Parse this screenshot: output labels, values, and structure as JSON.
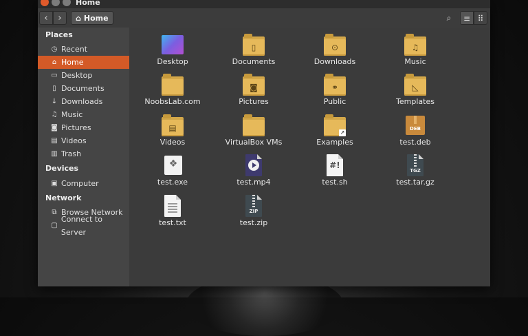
{
  "window": {
    "title": "Home"
  },
  "toolbar": {
    "back_icon": "‹",
    "forward_icon": "›",
    "breadcrumb_label": "Home",
    "search_icon": "⌕",
    "list_icon": "≡",
    "grid_icon": "⠿"
  },
  "sidebar": {
    "places_title": "Places",
    "places": [
      {
        "label": "Recent",
        "icon": "clock-icon",
        "glyph": "◷"
      },
      {
        "label": "Home",
        "icon": "home-icon",
        "glyph": "⌂",
        "selected": true
      },
      {
        "label": "Desktop",
        "icon": "folder-icon",
        "glyph": "▭"
      },
      {
        "label": "Documents",
        "icon": "document-icon",
        "glyph": "▯"
      },
      {
        "label": "Downloads",
        "icon": "download-icon",
        "glyph": "↓"
      },
      {
        "label": "Music",
        "icon": "music-icon",
        "glyph": "♫"
      },
      {
        "label": "Pictures",
        "icon": "camera-icon",
        "glyph": "◙"
      },
      {
        "label": "Videos",
        "icon": "film-icon",
        "glyph": "▤"
      },
      {
        "label": "Trash",
        "icon": "trash-icon",
        "glyph": "▥"
      }
    ],
    "devices_title": "Devices",
    "devices": [
      {
        "label": "Computer",
        "icon": "drive-icon",
        "glyph": "▣"
      }
    ],
    "network_title": "Network",
    "network": [
      {
        "label": "Browse Network",
        "icon": "network-icon",
        "glyph": "⧉"
      },
      {
        "label": "Connect to Server",
        "icon": "server-icon",
        "glyph": "▢"
      }
    ]
  },
  "files": [
    {
      "label": "Desktop",
      "type": "desktop"
    },
    {
      "label": "Documents",
      "type": "folder",
      "emblem": "▯"
    },
    {
      "label": "Downloads",
      "type": "folder",
      "emblem": "⊙"
    },
    {
      "label": "Music",
      "type": "folder",
      "emblem": "♫"
    },
    {
      "label": "NoobsLab.com",
      "type": "folder",
      "emblem": ""
    },
    {
      "label": "Pictures",
      "type": "folder",
      "emblem": "◙"
    },
    {
      "label": "Public",
      "type": "folder",
      "emblem": "⚭"
    },
    {
      "label": "Templates",
      "type": "folder",
      "emblem": "◺"
    },
    {
      "label": "Videos",
      "type": "folder",
      "emblem": "▤"
    },
    {
      "label": "VirtualBox VMs",
      "type": "folder",
      "emblem": ""
    },
    {
      "label": "Examples",
      "type": "folder-link",
      "emblem": ""
    },
    {
      "label": "test.deb",
      "type": "deb",
      "badge": "DEB"
    },
    {
      "label": "test.exe",
      "type": "exe",
      "mark": "❖"
    },
    {
      "label": "test.mp4",
      "type": "mp4"
    },
    {
      "label": "test.sh",
      "type": "script",
      "mark": "#!"
    },
    {
      "label": "test.tar.gz",
      "type": "archive",
      "badge": "TGZ"
    },
    {
      "label": "test.txt",
      "type": "text"
    },
    {
      "label": "test.zip",
      "type": "archive",
      "badge": "ZIP"
    }
  ],
  "colors": {
    "accent": "#d35a27",
    "folder": "#e6b95a",
    "sidebar_bg": "#454545",
    "content_bg": "#3b3b3b"
  }
}
